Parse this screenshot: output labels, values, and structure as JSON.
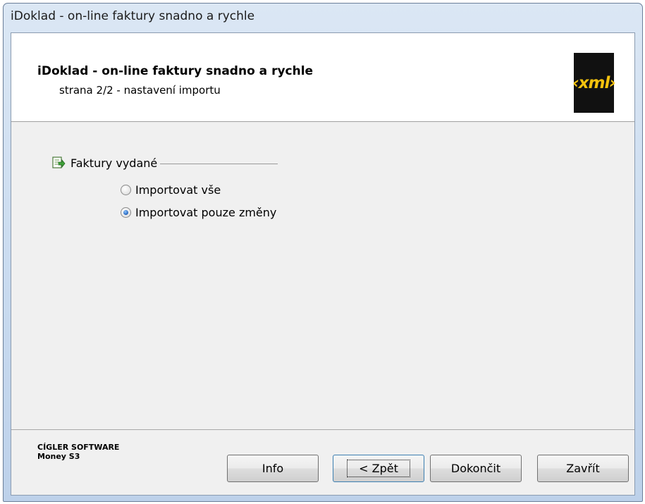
{
  "window": {
    "title": "iDoklad - on-line faktury snadno a rychle"
  },
  "header": {
    "title": "iDoklad - on-line faktury snadno a rychle",
    "subtitle": "strana 2/2 - nastavení importu",
    "logo_text": "xml",
    "logo_icon": "xml-logo"
  },
  "group": {
    "label": "Faktury vydané",
    "icon": "document-export-icon",
    "options": [
      {
        "label": "Importovat vše",
        "checked": false
      },
      {
        "label": "Importovat pouze změny",
        "checked": true
      }
    ]
  },
  "footer": {
    "brand_line1": "CÍGLER SOFTWARE",
    "brand_line2": "Money S3"
  },
  "buttons": {
    "info": "Info",
    "back": "< Zpět",
    "finish": "Dokončit",
    "close": "Zavřít"
  },
  "colors": {
    "logo_bg": "#111111",
    "logo_text": "#f4c20d",
    "accent": "#3c7fb1"
  }
}
